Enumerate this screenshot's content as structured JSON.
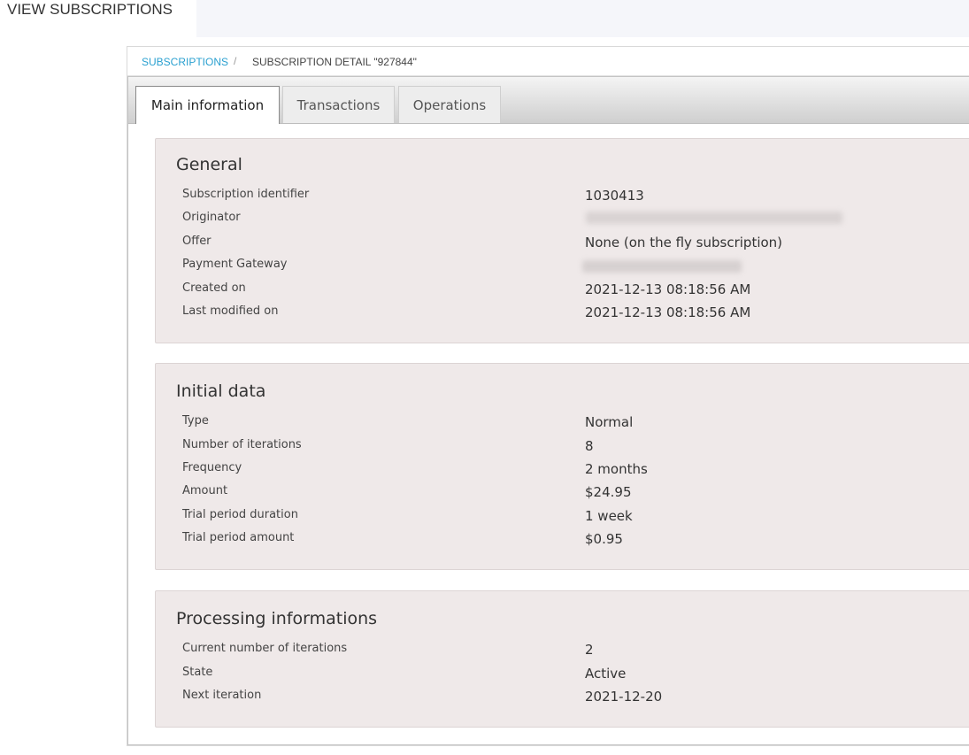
{
  "page": {
    "title": "VIEW SUBSCRIPTIONS"
  },
  "breadcrumb": {
    "link": "SUBSCRIPTIONS",
    "separator": "/",
    "current": "SUBSCRIPTION DETAIL \"927844\""
  },
  "tabs": [
    {
      "label": "Main information",
      "active": true
    },
    {
      "label": "Transactions",
      "active": false
    },
    {
      "label": "Operations",
      "active": false
    }
  ],
  "sections": {
    "general": {
      "title": "General",
      "rows": [
        {
          "label": "Subscription identifier",
          "value": "1030413"
        },
        {
          "label": "Originator",
          "value": ""
        },
        {
          "label": "Offer",
          "value": "None (on the fly subscription)"
        },
        {
          "label": "Payment Gateway",
          "value": ""
        },
        {
          "label": "Created on",
          "value": "2021-12-13 08:18:56 AM"
        },
        {
          "label": "Last modified on",
          "value": "2021-12-13 08:18:56 AM"
        }
      ]
    },
    "initial": {
      "title": "Initial data",
      "rows": [
        {
          "label": "Type",
          "value": "Normal"
        },
        {
          "label": "Number of iterations",
          "value": "8"
        },
        {
          "label": "Frequency",
          "value": "2 months"
        },
        {
          "label": "Amount",
          "value": "$24.95"
        },
        {
          "label": "Trial period duration",
          "value": "1 week"
        },
        {
          "label": "Trial period amount",
          "value": "$0.95"
        }
      ]
    },
    "processing": {
      "title": "Processing informations",
      "rows": [
        {
          "label": "Current number of iterations",
          "value": "2"
        },
        {
          "label": "State",
          "value": "Active"
        },
        {
          "label": "Next iteration",
          "value": "2021-12-20"
        }
      ]
    }
  },
  "colors": {
    "accent_link": "#2aa0d0",
    "section_bg": "#efe9e9"
  }
}
